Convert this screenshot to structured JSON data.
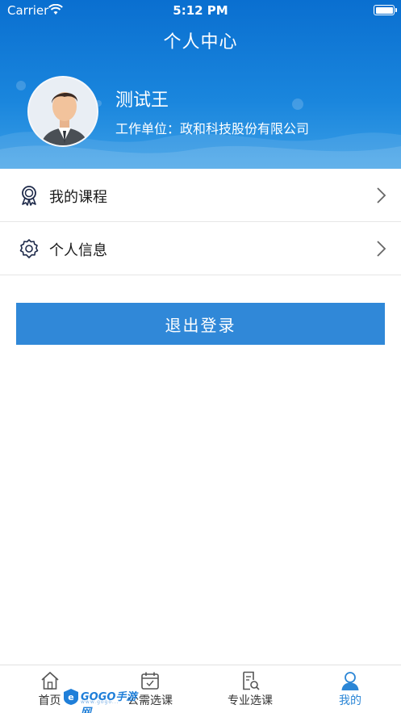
{
  "status_bar": {
    "carrier": "Carrier",
    "time": "5:12 PM"
  },
  "header": {
    "title": "个人中心"
  },
  "profile": {
    "name": "测试王",
    "org_label": "工作单位：",
    "org_value": "政和科技股份有限公司"
  },
  "menu": {
    "items": [
      {
        "label": "我的课程",
        "icon": "award-ribbon-icon"
      },
      {
        "label": "个人信息",
        "icon": "gear-icon"
      }
    ]
  },
  "logout_label": "退出登录",
  "tabbar": {
    "tabs": [
      {
        "label": "首页",
        "icon": "home-icon",
        "active": false
      },
      {
        "label": "公需选课",
        "icon": "calendar-icon",
        "active": false
      },
      {
        "label": "专业选课",
        "icon": "document-search-icon",
        "active": false
      },
      {
        "label": "我的",
        "icon": "user-icon",
        "active": true
      }
    ]
  },
  "watermark": {
    "text": "GOGO手游网",
    "sub": "www.gogo..."
  },
  "colors": {
    "header_blue": "#0a6fd0",
    "button_blue": "#3088d8",
    "active_tab": "#2b86d6"
  }
}
